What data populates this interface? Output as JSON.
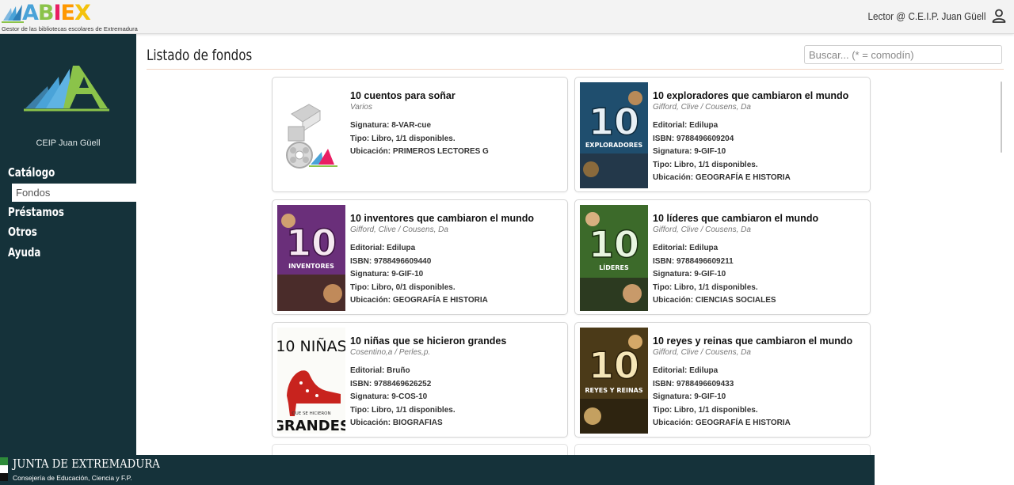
{
  "header": {
    "logo_text": "ABIEX",
    "logo_subtitle": "Gestor de las bibliotecas escolares de Extremadura",
    "user_label": "Lector @ C.E.I.P. Juan Güell",
    "user_icon": "user-icon"
  },
  "sidebar": {
    "school_logo": "school-logo",
    "school_name": "CEIP Juan Güell",
    "sections": [
      {
        "label": "Catálogo"
      },
      {
        "label": "Préstamos"
      },
      {
        "label": "Otros"
      },
      {
        "label": "Ayuda"
      }
    ],
    "active_item": "Fondos"
  },
  "main": {
    "title": "Listado de fondos",
    "search_placeholder": "Buscar... (* = comodín)",
    "items": [
      {
        "title": "10 cuentos para soñar",
        "author": "Varios",
        "signatura": "Signatura: 8-VAR-cue",
        "tipo": "Tipo: Libro, 1/1 disponibles.",
        "ubicacion": "Ubicación: PRIMEROS LECTORES G",
        "cover": "placeholder-media-icon"
      },
      {
        "title": "10 exploradores que cambiaron el mundo",
        "author": "Gifford, Clive / Cousens, Da",
        "editorial": "Editorial: Edilupa",
        "isbn": "ISBN: 9788496609204",
        "signatura": "Signatura: 9-GIF-10",
        "tipo": "Tipo: Libro, 1/1 disponibles.",
        "ubicacion": "Ubicación: GEOGRAFÍA E HISTORIA",
        "cover": "book-cover",
        "cover_number": "10",
        "cover_word": "EXPLORADORES",
        "cover_color": "#1f4e6e"
      },
      {
        "title": "10 inventores que cambiaron el mundo",
        "author": "Gifford, Clive / Cousens, Da",
        "editorial": "Editorial: Edilupa",
        "isbn": "ISBN: 9788496609440",
        "signatura": "Signatura: 9-GIF-10",
        "tipo": "Tipo: Libro, 0/1 disponibles.",
        "ubicacion": "Ubicación: GEOGRAFÍA E HISTORIA",
        "cover": "book-cover",
        "cover_number": "10",
        "cover_word": "INVENTORES",
        "cover_color": "#6a2f7a"
      },
      {
        "title": "10 líderes que cambiaron el mundo",
        "author": "Gifford, Clive / Cousens, Da",
        "editorial": "Editorial: Edilupa",
        "isbn": "ISBN: 9788496609211",
        "signatura": "Signatura: 9-GIF-10",
        "tipo": "Tipo: Libro, 1/1 disponibles.",
        "ubicacion": "Ubicación: CIENCIAS SOCIALES",
        "cover": "book-cover",
        "cover_number": "10",
        "cover_word": "LÍDERES",
        "cover_color": "#3c6a2a"
      },
      {
        "title": "10 niñas que se hicieron grandes",
        "author": "Cosentino,a / Perles,p.",
        "editorial": "Editorial: Bruño",
        "isbn": "ISBN: 9788469626252",
        "signatura": "Signatura: 9-COS-10",
        "tipo": "Tipo: Libro, 1/1 disponibles.",
        "ubicacion": "Ubicación: BIOGRAFIAS",
        "cover": "book-cover",
        "cover_top": "10 NIÑAS",
        "cover_mid": "QUE SE HICIERON",
        "cover_bottom": "GRANDES"
      },
      {
        "title": "10 reyes y reinas que cambiaron el mundo",
        "author": "Gifford, Clive / Cousens, Da",
        "editorial": "Editorial: Edilupa",
        "isbn": "ISBN: 9788496609433",
        "signatura": "Signatura: 9-GIF-10",
        "tipo": "Tipo: Libro, 1/1 disponibles.",
        "ubicacion": "Ubicación: GEOGRAFÍA E HISTORIA",
        "cover": "book-cover",
        "cover_number": "10",
        "cover_word": "REYES Y REINAS",
        "cover_color": "#4b3a18"
      }
    ]
  },
  "footer": {
    "title": "JUNTA DE EXTREMADURA",
    "subtitle": "Consejería de Educación, Ciencia y F.P."
  },
  "colors": {
    "sidebar_bg": "#15323a",
    "accent_divider": "#f1d5c3",
    "logo_a": "#4aa3d8",
    "logo_b": "#8bc34a",
    "logo_i": "#e91e63",
    "logo_e": "#ff9800",
    "logo_x": "#f4c20d"
  }
}
